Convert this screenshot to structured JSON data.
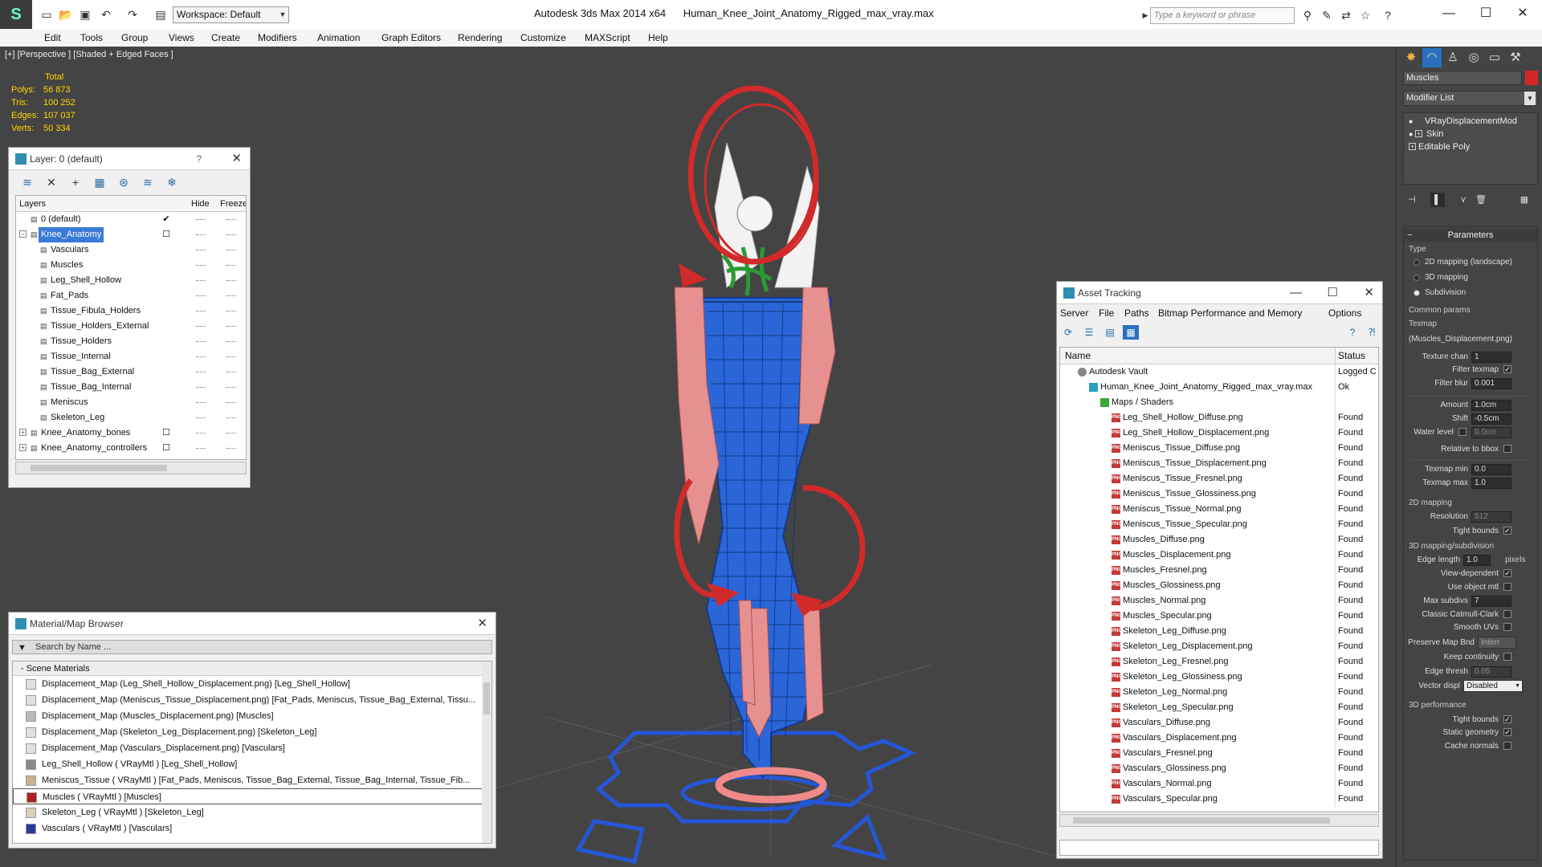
{
  "titlebar": {
    "workspace": "Workspace: Default",
    "app": "Autodesk 3ds Max  2014 x64",
    "file": "Human_Knee_Joint_Anatomy_Rigged_max_vray.max",
    "search_placeholder": "Type a keyword or phrase"
  },
  "menu": [
    "Edit",
    "Tools",
    "Group",
    "Views",
    "Create",
    "Modifiers",
    "Animation",
    "Graph Editors",
    "Rendering",
    "Customize",
    "MAXScript",
    "Help"
  ],
  "viewport": {
    "label": "[+] [Perspective ] [Shaded + Edged Faces ]",
    "stats_header": "Total",
    "stats": [
      {
        "label": "Polys:",
        "value": "56 873"
      },
      {
        "label": "Tris:",
        "value": "100 252"
      },
      {
        "label": "Edges:",
        "value": "107 037"
      },
      {
        "label": "Verts:",
        "value": "50 334"
      }
    ]
  },
  "layer_panel": {
    "title": "Layer: 0 (default)",
    "help": "?",
    "col_layers": "Layers",
    "col_hide": "Hide",
    "col_freeze": "Freeze",
    "rows": [
      {
        "name": "0 (default)",
        "level": 0,
        "check": "✔",
        "expander": ""
      },
      {
        "name": "Knee_Anatomy",
        "level": 0,
        "check": "☐",
        "expander": "−",
        "selected": true
      },
      {
        "name": "Vasculars",
        "level": 1
      },
      {
        "name": "Muscles",
        "level": 1
      },
      {
        "name": "Leg_Shell_Hollow",
        "level": 1
      },
      {
        "name": "Fat_Pads",
        "level": 1
      },
      {
        "name": "Tissue_Fibula_Holders",
        "level": 1
      },
      {
        "name": "Tissue_Holders_External",
        "level": 1
      },
      {
        "name": "Tissue_Holders",
        "level": 1
      },
      {
        "name": "Tissue_Internal",
        "level": 1
      },
      {
        "name": "Tissue_Bag_External",
        "level": 1
      },
      {
        "name": "Tissue_Bag_Internal",
        "level": 1
      },
      {
        "name": "Meniscus",
        "level": 1
      },
      {
        "name": "Skeleton_Leg",
        "level": 1
      },
      {
        "name": "Knee_Anatomy_bones",
        "level": 0,
        "check": "☐",
        "expander": "+"
      },
      {
        "name": "Knee_Anatomy_controllers",
        "level": 0,
        "check": "☐",
        "expander": "+"
      }
    ]
  },
  "material_browser": {
    "title": "Material/Map Browser",
    "search_placeholder": "Search by Name ...",
    "group": "- Scene Materials",
    "rows": [
      {
        "text": "Displacement_Map (Leg_Shell_Hollow_Displacement.png) [Leg_Shell_Hollow]",
        "swatch": "#e0e0e0"
      },
      {
        "text": "Displacement_Map (Meniscus_Tissue_Displacement.png) [Fat_Pads, Meniscus, Tissue_Bag_External, Tissu...",
        "swatch": "#e0e0e0"
      },
      {
        "text": "Displacement_Map (Muscles_Displacement.png) [Muscles]",
        "swatch": "#b9b9b9"
      },
      {
        "text": "Displacement_Map (Skeleton_Leg_Displacement.png) [Skeleton_Leg]",
        "swatch": "#e0e0e0"
      },
      {
        "text": "Displacement_Map (Vasculars_Displacement.png) [Vasculars]",
        "swatch": "#e0e0e0"
      },
      {
        "text": "Leg_Shell_Hollow  ( VRayMtl ) [Leg_Shell_Hollow]",
        "swatch": "#8a8a8a"
      },
      {
        "text": "Meniscus_Tissue  ( VRayMtl ) [Fat_Pads, Meniscus, Tissue_Bag_External, Tissue_Bag_Internal, Tissue_Fib...",
        "swatch": "#c9b28e"
      },
      {
        "text": "Muscles  ( VRayMtl ) [Muscles]",
        "swatch": "#b02020",
        "selected": true
      },
      {
        "text": "Skeleton_Leg  ( VRayMtl ) [Skeleton_Leg]",
        "swatch": "#d8d0b8"
      },
      {
        "text": "Vasculars  ( VRayMtl ) [Vasculars]",
        "swatch": "#2a3c9a"
      }
    ]
  },
  "asset_tracking": {
    "title": "Asset Tracking",
    "menu": [
      "Server",
      "File",
      "Paths",
      "Bitmap Performance and Memory",
      "Options"
    ],
    "col_name": "Name",
    "col_status": "Status",
    "rows": [
      {
        "name": "Autodesk Vault",
        "status": "Logged C",
        "indent": 1,
        "icon": "vault"
      },
      {
        "name": "Human_Knee_Joint_Anatomy_Rigged_max_vray.max",
        "status": "Ok",
        "indent": 2,
        "icon": "max"
      },
      {
        "name": "Maps / Shaders",
        "status": "",
        "indent": 3,
        "icon": "folder"
      },
      {
        "name": "Leg_Shell_Hollow_Diffuse.png",
        "status": "Found",
        "indent": 4,
        "icon": "png"
      },
      {
        "name": "Leg_Shell_Hollow_Displacement.png",
        "status": "Found",
        "indent": 4,
        "icon": "png"
      },
      {
        "name": "Meniscus_Tissue_Diffuse.png",
        "status": "Found",
        "indent": 4,
        "icon": "png"
      },
      {
        "name": "Meniscus_Tissue_Displacement.png",
        "status": "Found",
        "indent": 4,
        "icon": "png"
      },
      {
        "name": "Meniscus_Tissue_Fresnel.png",
        "status": "Found",
        "indent": 4,
        "icon": "png"
      },
      {
        "name": "Meniscus_Tissue_Glossiness.png",
        "status": "Found",
        "indent": 4,
        "icon": "png"
      },
      {
        "name": "Meniscus_Tissue_Normal.png",
        "status": "Found",
        "indent": 4,
        "icon": "png"
      },
      {
        "name": "Meniscus_Tissue_Specular.png",
        "status": "Found",
        "indent": 4,
        "icon": "png"
      },
      {
        "name": "Muscles_Diffuse.png",
        "status": "Found",
        "indent": 4,
        "icon": "png"
      },
      {
        "name": "Muscles_Displacement.png",
        "status": "Found",
        "indent": 4,
        "icon": "png"
      },
      {
        "name": "Muscles_Fresnel.png",
        "status": "Found",
        "indent": 4,
        "icon": "png"
      },
      {
        "name": "Muscles_Glossiness.png",
        "status": "Found",
        "indent": 4,
        "icon": "png"
      },
      {
        "name": "Muscles_Normal.png",
        "status": "Found",
        "indent": 4,
        "icon": "png"
      },
      {
        "name": "Muscles_Specular.png",
        "status": "Found",
        "indent": 4,
        "icon": "png"
      },
      {
        "name": "Skeleton_Leg_Diffuse.png",
        "status": "Found",
        "indent": 4,
        "icon": "png"
      },
      {
        "name": "Skeleton_Leg_Displacement.png",
        "status": "Found",
        "indent": 4,
        "icon": "png"
      },
      {
        "name": "Skeleton_Leg_Fresnel.png",
        "status": "Found",
        "indent": 4,
        "icon": "png"
      },
      {
        "name": "Skeleton_Leg_Glossiness.png",
        "status": "Found",
        "indent": 4,
        "icon": "png"
      },
      {
        "name": "Skeleton_Leg_Normal.png",
        "status": "Found",
        "indent": 4,
        "icon": "png"
      },
      {
        "name": "Skeleton_Leg_Specular.png",
        "status": "Found",
        "indent": 4,
        "icon": "png"
      },
      {
        "name": "Vasculars_Diffuse.png",
        "status": "Found",
        "indent": 4,
        "icon": "png"
      },
      {
        "name": "Vasculars_Displacement.png",
        "status": "Found",
        "indent": 4,
        "icon": "png"
      },
      {
        "name": "Vasculars_Fresnel.png",
        "status": "Found",
        "indent": 4,
        "icon": "png"
      },
      {
        "name": "Vasculars_Glossiness.png",
        "status": "Found",
        "indent": 4,
        "icon": "png"
      },
      {
        "name": "Vasculars_Normal.png",
        "status": "Found",
        "indent": 4,
        "icon": "png"
      },
      {
        "name": "Vasculars_Specular.png",
        "status": "Found",
        "indent": 4,
        "icon": "png"
      }
    ]
  },
  "command_panel": {
    "object_name": "Muscles",
    "object_color": "#d42828",
    "modifier_list": "Modifier List",
    "stack": [
      "VRayDisplacementMod",
      "Skin",
      "Editable Poly"
    ],
    "parameters": "Parameters",
    "type_label": "Type",
    "type_options": [
      {
        "label": "2D mapping (landscape)",
        "on": false
      },
      {
        "label": "3D mapping",
        "on": false
      },
      {
        "label": "Subdivision",
        "on": true
      }
    ],
    "common_params": "Common params",
    "texmap_label": "Texmap",
    "texmap_name": "(Muscles_Displacement.png)",
    "texture_chan_label": "Texture chan",
    "texture_chan": "1",
    "filter_texmap": "Filter texmap",
    "filter_blur_label": "Filter blur",
    "filter_blur": "0.001",
    "amount_label": "Amount",
    "amount": "1.0cm",
    "shift_label": "Shift",
    "shift": "-0.5cm",
    "water_level_label": "Water level",
    "water_level": "0.0cm",
    "relative_bbox": "Relative to bbox",
    "texmap_min_label": "Texmap min",
    "texmap_min": "0.0",
    "texmap_max_label": "Texmap max",
    "texmap_max": "1.0",
    "mapping2d": "2D mapping",
    "resolution_label": "Resolution",
    "resolution": "512",
    "tight_bounds": "Tight bounds",
    "mapping3d": "3D mapping/subdivision",
    "edge_length_label": "Edge length",
    "edge_length": "1.0",
    "pixels": "pixels",
    "view_dependent": "View-dependent",
    "use_object_mtl": "Use object mtl",
    "max_subdivs_label": "Max subdivs",
    "max_subdivs": "7",
    "classic_catmull": "Classic Catmull-Clark",
    "smooth_uvs": "Smooth UVs",
    "preserve_map_bnd": "Preserve Map Bnd",
    "preserve_value": "Interr",
    "keep_continuity": "Keep continuity",
    "edge_thresh_label": "Edge thresh",
    "edge_thresh": "0.05",
    "vector_displ_label": "Vector displ",
    "vector_displ": "Disabled",
    "perf3d": "3D performance",
    "tight_bounds2": "Tight bounds",
    "static_geometry": "Static geometry",
    "cache_normals": "Cache normals"
  }
}
